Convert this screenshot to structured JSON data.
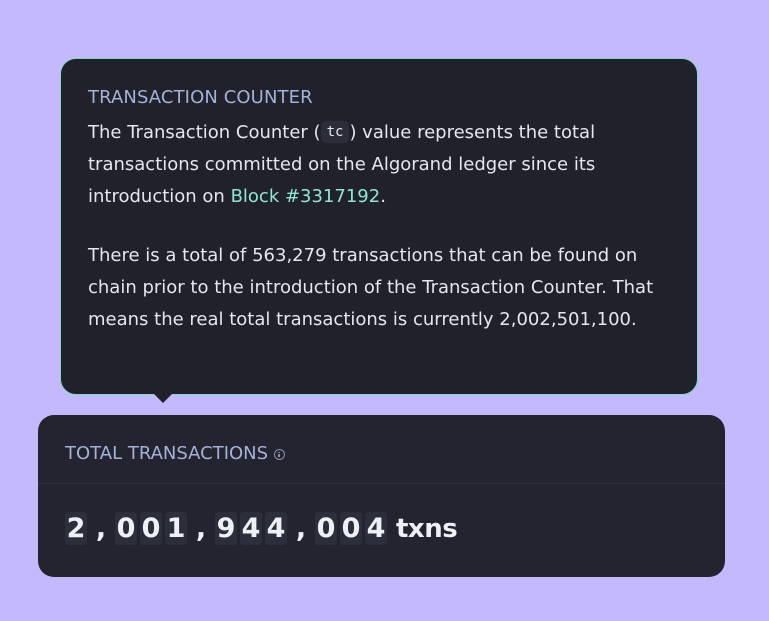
{
  "tooltip": {
    "title": "TRANSACTION COUNTER",
    "para1_a": "The Transaction Counter (",
    "para1_code": "tc",
    "para1_b": ") value represents the total transactions committed on the Algorand ledger since its introduction on ",
    "para1_link": "Block #3317192",
    "para1_c": ".",
    "para2": "There is a total of 563,279 transactions that can be found on chain prior to the introduction of the Transaction Counter. That means the real total transactions is currently 2,002,501,100."
  },
  "card": {
    "title": "TOTAL TRANSACTIONS",
    "info_icon": "info-icon",
    "value": "2,001,944,004",
    "unit": "txns"
  },
  "colors": {
    "background": "#c4b9fc",
    "panel": "#20212b",
    "accent_link": "#8fe7d3",
    "title": "#a6b1d8"
  }
}
